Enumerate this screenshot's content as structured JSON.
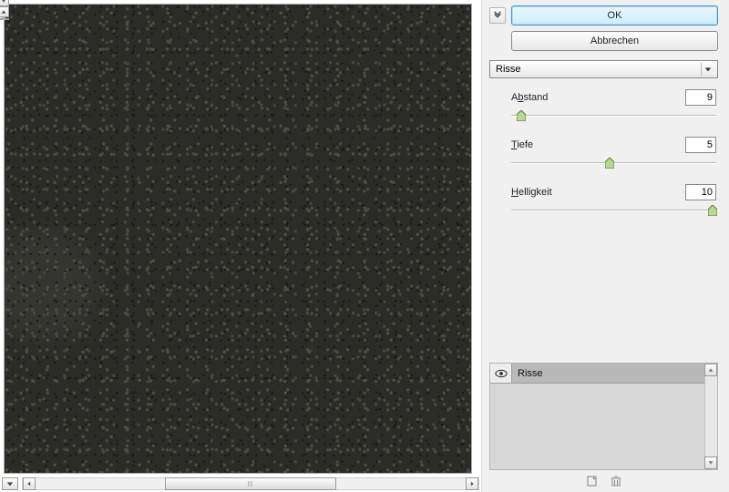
{
  "buttons": {
    "ok": "OK",
    "cancel": "Abbrechen"
  },
  "filter_dropdown": {
    "selected": "Risse"
  },
  "sliders": {
    "abstand": {
      "label_pre": "A",
      "label_ul": "b",
      "label_post": "stand",
      "value": "9",
      "pos_pct": 5
    },
    "tiefe": {
      "label_pre": "",
      "label_ul": "T",
      "label_post": "iefe",
      "value": "5",
      "pos_pct": 48
    },
    "helligkeit": {
      "label_pre": "",
      "label_ul": "H",
      "label_post": "elligkeit",
      "value": "10",
      "pos_pct": 98
    }
  },
  "layers": {
    "row1_name": "Risse"
  }
}
